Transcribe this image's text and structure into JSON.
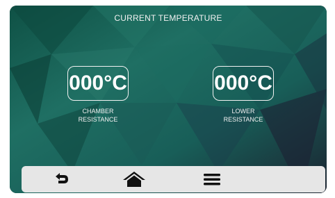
{
  "header": {
    "title": "CURRENT TEMPERATURE"
  },
  "readings": [
    {
      "value": "000°C",
      "label_line1": "CHAMBER",
      "label_line2": "RESISTANCE"
    },
    {
      "value": "000°C",
      "label_line1": "LOWER",
      "label_line2": "RESISTANCE"
    }
  ],
  "navbar": {
    "back_icon": "back-arrow-icon",
    "home_icon": "home-icon",
    "menu_icon": "hamburger-menu-icon"
  },
  "colors": {
    "background_teal": "#1f6f63",
    "background_dark": "#1b2330",
    "text": "#f2f2f2",
    "navbar": "#e6e6e6",
    "icon": "#111111"
  }
}
